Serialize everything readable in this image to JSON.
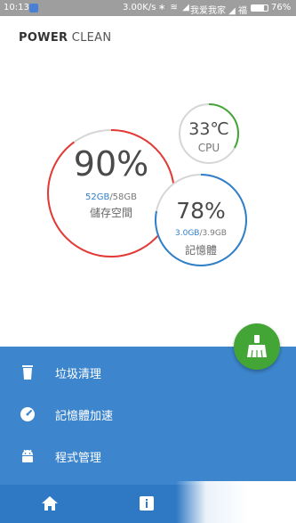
{
  "status_bar": {
    "time": "10:13",
    "network_speed": "3.00K/s",
    "status_icons": "∗ ≋ ◢",
    "carrier": "我爱我家 ◢ 福",
    "battery_percent": "76%",
    "battery_level": 0.76
  },
  "app": {
    "title_bold": "POWER",
    "title_light": "CLEAN"
  },
  "storage": {
    "percent": "90%",
    "percent_value": 90,
    "used": "52GB",
    "total": "/58GB",
    "label": "儲存空間",
    "arc_color": "#e53935"
  },
  "cpu": {
    "temperature": "33℃",
    "temperature_value": 33,
    "label": "CPU",
    "arc_color": "#43a536"
  },
  "memory": {
    "percent": "78%",
    "percent_value": 78,
    "used": "3.0GB",
    "total": "/3.9GB",
    "label": "記憶體",
    "arc_color": "#2f7fc9"
  },
  "menu": {
    "items": [
      {
        "label": "垃圾清理",
        "icon": "trash-icon"
      },
      {
        "label": "記憶體加速",
        "icon": "speedometer-icon"
      },
      {
        "label": "程式管理",
        "icon": "android-icon"
      }
    ]
  },
  "fab": {
    "icon": "broom-icon",
    "color": "#43a536"
  },
  "bottom_nav": {
    "items": [
      "home-icon",
      "info-icon"
    ]
  },
  "colors": {
    "panel": "#3d86cd",
    "nav": "#2f78c3",
    "accent": "#2f7fc9"
  }
}
